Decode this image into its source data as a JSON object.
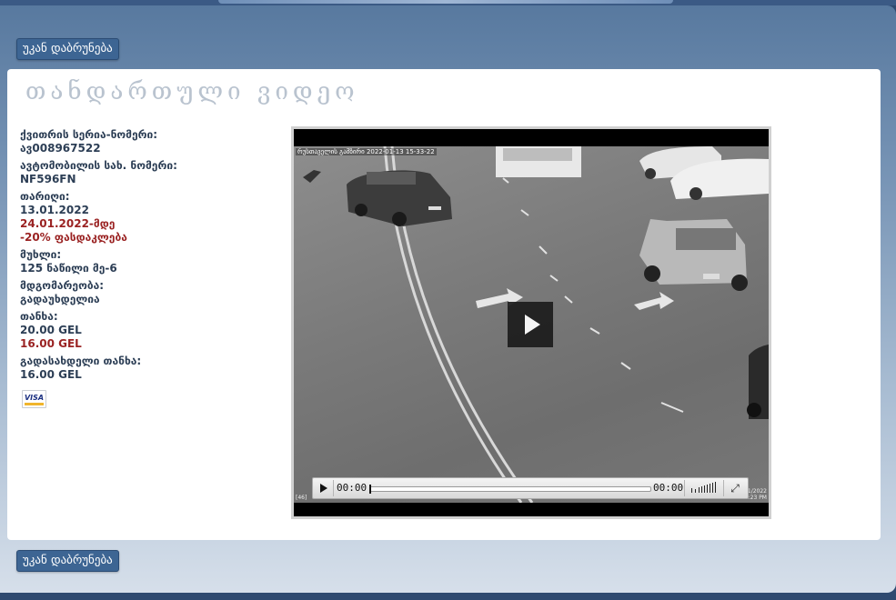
{
  "navigation": {
    "back_label": "უკან დაბრუნება"
  },
  "page": {
    "title": "თანდართული ვიდეო"
  },
  "details": {
    "receipt_label": "ქვითრის სერია-ნომერი:",
    "receipt_value": "ავ008967522",
    "plate_label": "ავტომობილის სახ. ნომერი:",
    "plate_value": "NF596FN",
    "date_label": "თარიღი:",
    "date_value": "13.01.2022",
    "discount_deadline": "24.01.2022-მდე",
    "discount_text": "-20% ფასდაკლება",
    "article_label": "მუხლი:",
    "article_value": "125 ნაწილი მე-6",
    "status_label": "მდგომარეობა:",
    "status_value": "გადაუხდელია",
    "amount_label": "თანხა:",
    "amount_value": "20.00 GEL",
    "amount_discounted": "16.00 GEL",
    "payable_label": "გადასახდელი თანხა:",
    "payable_value": "16.00 GEL"
  },
  "payment": {
    "card_icon": "visa-card-icon",
    "card_text": "VISA"
  },
  "video": {
    "overlay_text": "რუსთაველის გამზირი 2022-01-13 15-33-22",
    "current_time": "00:00",
    "duration": "00:00",
    "progress": 0,
    "corner_date": "1/2022",
    "corner_time": "3:23 PM",
    "corner_left": "[46]"
  },
  "colors": {
    "button_bg": "#3d6593",
    "text": "#2c3e55",
    "discount_red": "#9a2222",
    "title": "#b9c3cf"
  }
}
